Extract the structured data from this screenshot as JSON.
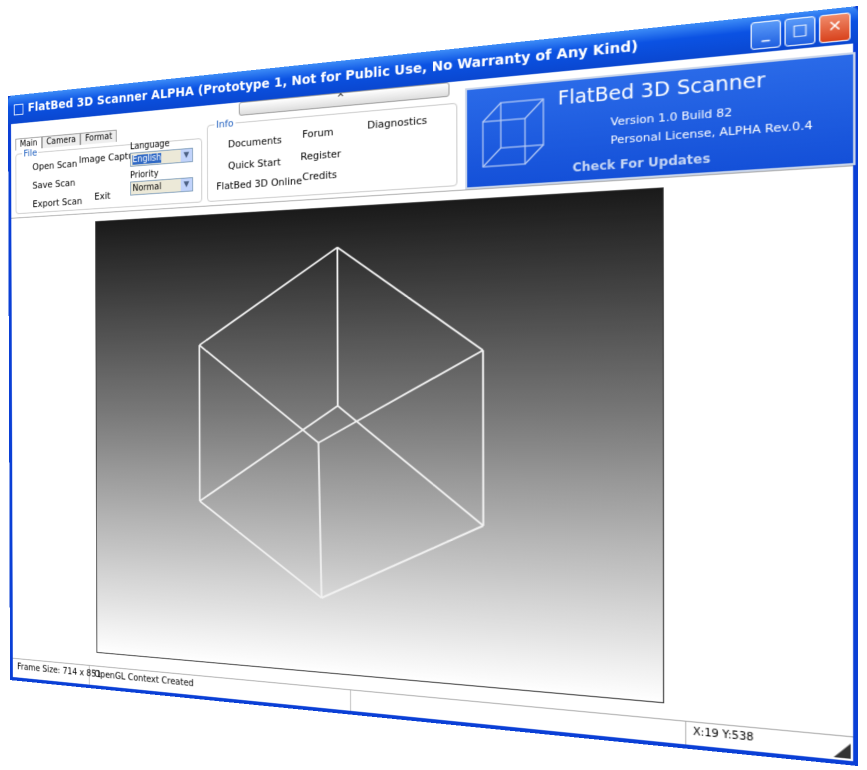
{
  "window": {
    "title": "FlatBed 3D Scanner ALPHA (Prototype 1, Not for Public Use, No Warranty of Any Kind)",
    "buttons": [
      "minimize",
      "maximize",
      "close"
    ]
  },
  "ribbon": {
    "collapse_icon": "chevron-up",
    "collapse_label": "^",
    "tabs": [
      "Main",
      "Camera",
      "Format"
    ],
    "file": {
      "label": "File",
      "open": "Open Scan",
      "save": "Save Scan",
      "export": "Export Scan",
      "capture": "Image Capture",
      "exit": "Exit",
      "language_label": "Language",
      "language_value": "English",
      "priority_label": "Priority",
      "priority_value": "Normal"
    },
    "info": {
      "label": "Info",
      "documents": "Documents",
      "quick_start": "Quick Start",
      "online": "FlatBed 3D Online",
      "forum": "Forum",
      "register": "Register",
      "credits": "Credits",
      "diagnostics": "Diagnostics"
    }
  },
  "about": {
    "name": "FlatBed 3D Scanner",
    "version": "Version 1.0  Build 82",
    "license": "Personal License, ALPHA Rev.0.4",
    "updates": "Check For Updates",
    "color": "#1a5ae0"
  },
  "status": {
    "frame_size": "Frame Size: 714 x 851",
    "message": "OpenGL Context Created",
    "empty": "",
    "coords": "X:19 Y:538"
  }
}
